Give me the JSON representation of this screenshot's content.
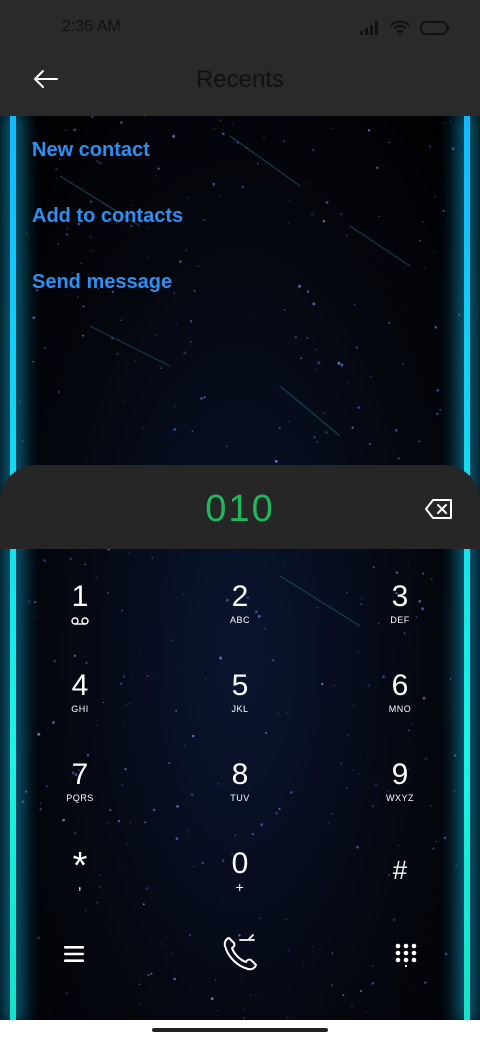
{
  "status": {
    "time": "2:36 AM"
  },
  "header": {
    "title": "Recents"
  },
  "menu": [
    "New contact",
    "Add to contacts",
    "Send message"
  ],
  "dialer": {
    "number": "010",
    "keys": [
      {
        "digit": "1",
        "letters": "∞"
      },
      {
        "digit": "2",
        "letters": "ABC"
      },
      {
        "digit": "3",
        "letters": "DEF"
      },
      {
        "digit": "4",
        "letters": "GHI"
      },
      {
        "digit": "5",
        "letters": "JKL"
      },
      {
        "digit": "6",
        "letters": "MNO"
      },
      {
        "digit": "7",
        "letters": "PQRS"
      },
      {
        "digit": "8",
        "letters": "TUV"
      },
      {
        "digit": "9",
        "letters": "WXYZ"
      },
      {
        "digit": "*",
        "letters": ","
      },
      {
        "digit": "0",
        "letters": "+"
      },
      {
        "digit": "#",
        "letters": ""
      }
    ]
  },
  "colors": {
    "menu_link": "#2e8ff0",
    "number": "#1fb85a",
    "edge_glow": "#12b8ff"
  },
  "icons": [
    "back-arrow-icon",
    "backspace-icon",
    "menu-icon",
    "call-icon",
    "dialpad-icon",
    "voicemail-icon"
  ]
}
